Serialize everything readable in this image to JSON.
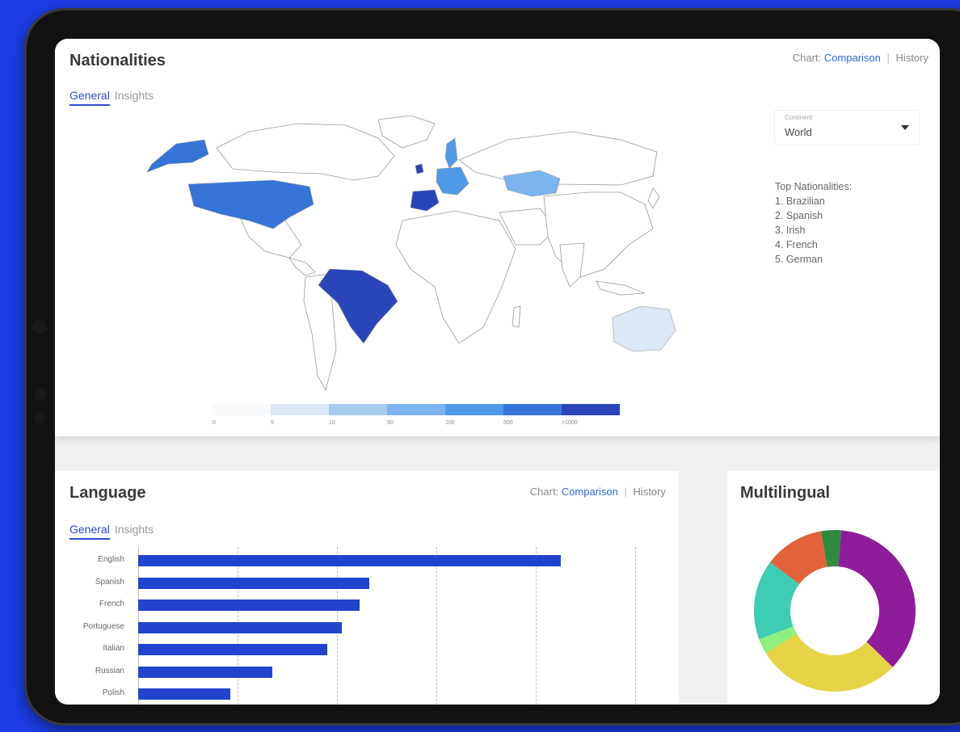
{
  "nationalities": {
    "title": "Nationalities",
    "tabs": [
      "General",
      "Insights"
    ],
    "chart_switch": {
      "label": "Chart:",
      "options": [
        "Comparison",
        "History"
      ]
    },
    "continent": {
      "label": "Continent",
      "value": "World"
    },
    "top_heading": "Top Nationalities:",
    "top_list": [
      "1. Brazilian",
      "2. Spanish",
      "3. Irish",
      "4. French",
      "5. German"
    ],
    "legend": {
      "labels": [
        "0",
        "5",
        "10",
        "50",
        "100",
        "500",
        ">1000"
      ],
      "colors": [
        "#f9fafc",
        "#dce8f6",
        "#a8cbef",
        "#7bb4ee",
        "#4f9ae7",
        "#3674d8",
        "#2a45b8"
      ]
    },
    "map_colors": {
      "brazil": "#2a45b8",
      "spain": "#2a45b8",
      "ireland": "#2a45b8",
      "usa": "#3674d8",
      "alaska": "#3674d8",
      "sweden": "#4f9ae7",
      "europe_mid": "#4f9ae7",
      "kazakhstan": "#7bb4ee",
      "australia": "#dce8f6"
    }
  },
  "language": {
    "title": "Language",
    "tabs": [
      "General",
      "Insights"
    ],
    "chart_switch": {
      "label": "Chart:",
      "options": [
        "Comparison",
        "History"
      ]
    }
  },
  "multilingual": {
    "title": "Multilingual"
  },
  "chart_data": [
    {
      "type": "bar",
      "orientation": "horizontal",
      "categories": [
        "English",
        "Spanish",
        "French",
        "Portuguese",
        "Italian",
        "Russian",
        "Polish"
      ],
      "values": [
        85,
        46.5,
        44.5,
        41,
        38,
        27,
        18.5
      ],
      "xlim": [
        0,
        100
      ],
      "grid": true
    },
    {
      "type": "pie",
      "donut": true,
      "slices": [
        {
          "value": 36,
          "color": "#8e1c9b"
        },
        {
          "value": 29,
          "color": "#e6d447"
        },
        {
          "value": 3,
          "color": "#8ff07e"
        },
        {
          "value": 16,
          "color": "#3ecdb2"
        },
        {
          "value": 12,
          "color": "#e2633a"
        },
        {
          "value": 4,
          "color": "#2e8b3e"
        }
      ]
    }
  ]
}
